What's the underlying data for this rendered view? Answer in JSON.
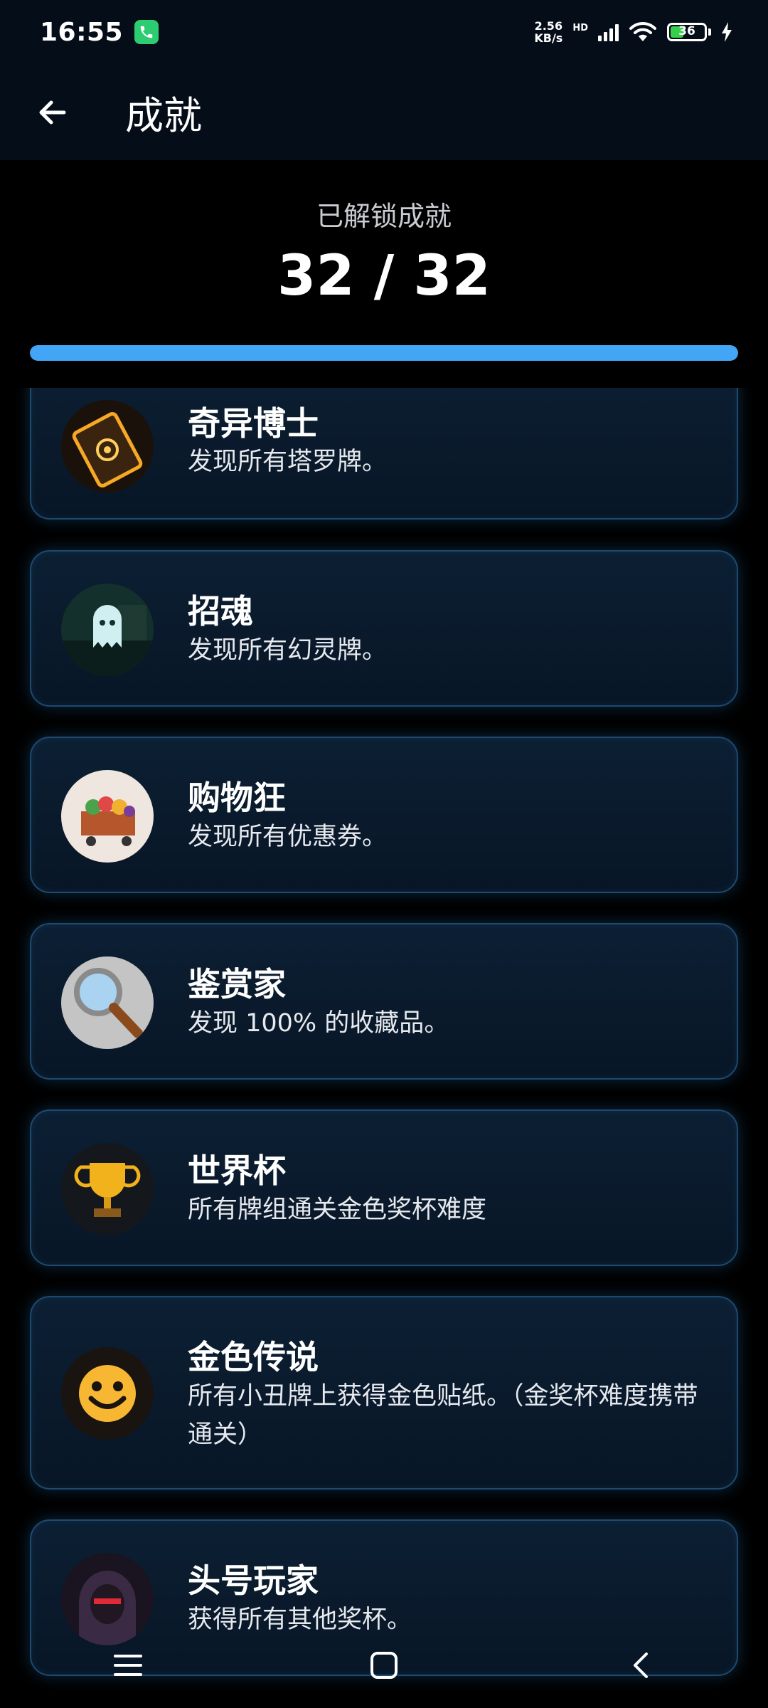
{
  "status": {
    "time": "16:55",
    "net_speed_value": "2.56",
    "net_speed_unit": "KB/s",
    "hd_label": "HD",
    "battery": "36"
  },
  "header": {
    "title": "成就"
  },
  "summary": {
    "label": "已解锁成就",
    "count": "32 / 32",
    "progress_fraction": 1.0
  },
  "achievements": [
    {
      "title": "奇异博士",
      "description": "发现所有塔罗牌。"
    },
    {
      "title": "招魂",
      "description": "发现所有幻灵牌。"
    },
    {
      "title": "购物狂",
      "description": "发现所有优惠券。"
    },
    {
      "title": "鉴赏家",
      "description": "发现 100% 的收藏品。"
    },
    {
      "title": "世界杯",
      "description": "所有牌组通关金色奖杯难度"
    },
    {
      "title": "金色传说",
      "description": "所有小丑牌上获得金色贴纸。（金奖杯难度携带通关）"
    },
    {
      "title": "头号玩家",
      "description": "获得所有其他奖杯。"
    }
  ],
  "icons": {
    "achievement_icons": [
      "tarot-card-icon",
      "ghost-icon",
      "shopping-cart-icon",
      "magnifier-icon",
      "trophy-icon",
      "golden-joker-icon",
      "hooded-player-icon"
    ]
  },
  "colors": {
    "accent": "#42a5f5",
    "card_border": "#1d4a70",
    "background": "#000000"
  }
}
